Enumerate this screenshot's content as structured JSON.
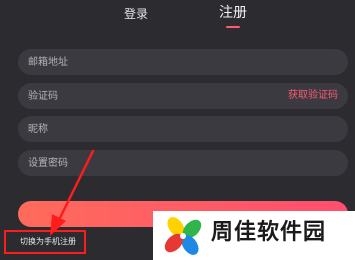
{
  "tabs": {
    "login": "登录",
    "register": "注册",
    "active": "register"
  },
  "form": {
    "email": {
      "placeholder": "邮箱地址",
      "value": ""
    },
    "code": {
      "placeholder": "验证码",
      "value": "",
      "action_label": "获取验证码"
    },
    "nickname": {
      "placeholder": "昵称",
      "value": ""
    },
    "password": {
      "placeholder": "设置密码",
      "value": ""
    },
    "submit_label": ""
  },
  "switch_link": "切换为手机注册",
  "watermark": {
    "text": "周佳软件园",
    "logo_icon": "pinwheel-logo"
  },
  "colors": {
    "background": "#2b2b30",
    "field": "#3a3a40",
    "accent": "#ff5a6e",
    "annotation_red": "#ff1c1c"
  }
}
